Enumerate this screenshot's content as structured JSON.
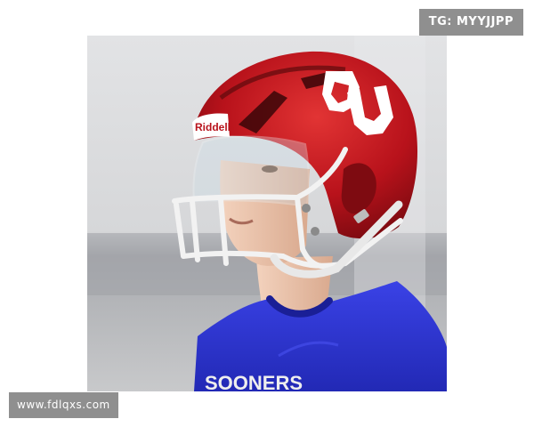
{
  "watermark_top": "TG: MYYJJPP",
  "watermark_bottom": "www.fdlqxs.com",
  "photo": {
    "helmet_brand": "Riddell",
    "jersey_text": "SOONERS",
    "colors": {
      "helmet": "#b8121b",
      "jersey": "#2c33d4",
      "background": "#d9dadc",
      "facemask": "#f2f2f2"
    }
  }
}
